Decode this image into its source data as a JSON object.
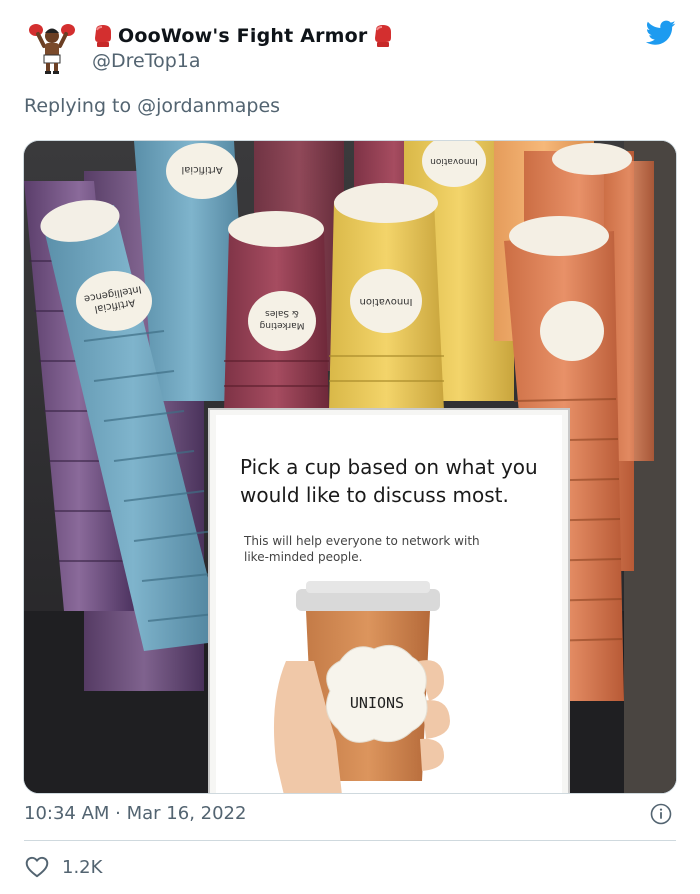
{
  "author": {
    "display_name": "OooWow's Fight Armor",
    "handle": "@DreTop1a",
    "avatar_icon": "boxer-avatar-icon",
    "name_emoji": "boxing-glove-icon"
  },
  "reply": {
    "prefix": "Replying to ",
    "target": "@jordanmapes"
  },
  "media": {
    "sign_heading_line1": "Pick a cup based on what you",
    "sign_heading_line2": "would like to discuss most.",
    "sign_sub_line1": "This will help everyone to network with",
    "sign_sub_line2": "like-minded people.",
    "cup_label": "UNIONS",
    "cup_texts": {
      "ai_a": "Artificial",
      "ai_b": "Intelligence",
      "ms_a": "Marketing",
      "ms_b": "& Sales",
      "innovation": "Innovation"
    }
  },
  "footer": {
    "time": "10:34 AM",
    "separator": " · ",
    "date": "Mar 16, 2022",
    "like_count": "1.2K"
  },
  "colors": {
    "twitter_blue": "#1d9bf0",
    "muted": "#536471",
    "glove_red": "#d32f2f"
  }
}
